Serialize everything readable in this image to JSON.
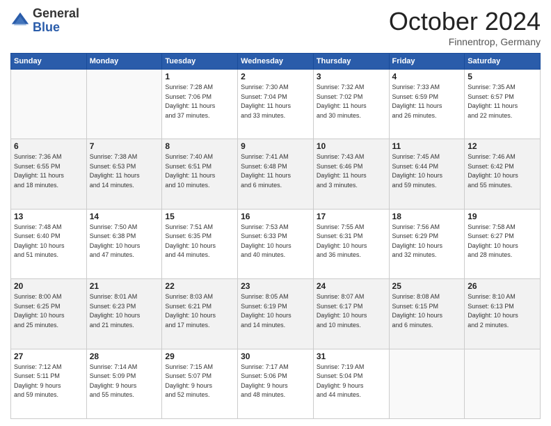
{
  "logo": {
    "general": "General",
    "blue": "Blue"
  },
  "header": {
    "title": "October 2024",
    "subtitle": "Finnentrop, Germany"
  },
  "weekdays": [
    "Sunday",
    "Monday",
    "Tuesday",
    "Wednesday",
    "Thursday",
    "Friday",
    "Saturday"
  ],
  "weeks": [
    [
      {
        "day": "",
        "info": ""
      },
      {
        "day": "",
        "info": ""
      },
      {
        "day": "1",
        "info": "Sunrise: 7:28 AM\nSunset: 7:06 PM\nDaylight: 11 hours\nand 37 minutes."
      },
      {
        "day": "2",
        "info": "Sunrise: 7:30 AM\nSunset: 7:04 PM\nDaylight: 11 hours\nand 33 minutes."
      },
      {
        "day": "3",
        "info": "Sunrise: 7:32 AM\nSunset: 7:02 PM\nDaylight: 11 hours\nand 30 minutes."
      },
      {
        "day": "4",
        "info": "Sunrise: 7:33 AM\nSunset: 6:59 PM\nDaylight: 11 hours\nand 26 minutes."
      },
      {
        "day": "5",
        "info": "Sunrise: 7:35 AM\nSunset: 6:57 PM\nDaylight: 11 hours\nand 22 minutes."
      }
    ],
    [
      {
        "day": "6",
        "info": "Sunrise: 7:36 AM\nSunset: 6:55 PM\nDaylight: 11 hours\nand 18 minutes."
      },
      {
        "day": "7",
        "info": "Sunrise: 7:38 AM\nSunset: 6:53 PM\nDaylight: 11 hours\nand 14 minutes."
      },
      {
        "day": "8",
        "info": "Sunrise: 7:40 AM\nSunset: 6:51 PM\nDaylight: 11 hours\nand 10 minutes."
      },
      {
        "day": "9",
        "info": "Sunrise: 7:41 AM\nSunset: 6:48 PM\nDaylight: 11 hours\nand 6 minutes."
      },
      {
        "day": "10",
        "info": "Sunrise: 7:43 AM\nSunset: 6:46 PM\nDaylight: 11 hours\nand 3 minutes."
      },
      {
        "day": "11",
        "info": "Sunrise: 7:45 AM\nSunset: 6:44 PM\nDaylight: 10 hours\nand 59 minutes."
      },
      {
        "day": "12",
        "info": "Sunrise: 7:46 AM\nSunset: 6:42 PM\nDaylight: 10 hours\nand 55 minutes."
      }
    ],
    [
      {
        "day": "13",
        "info": "Sunrise: 7:48 AM\nSunset: 6:40 PM\nDaylight: 10 hours\nand 51 minutes."
      },
      {
        "day": "14",
        "info": "Sunrise: 7:50 AM\nSunset: 6:38 PM\nDaylight: 10 hours\nand 47 minutes."
      },
      {
        "day": "15",
        "info": "Sunrise: 7:51 AM\nSunset: 6:35 PM\nDaylight: 10 hours\nand 44 minutes."
      },
      {
        "day": "16",
        "info": "Sunrise: 7:53 AM\nSunset: 6:33 PM\nDaylight: 10 hours\nand 40 minutes."
      },
      {
        "day": "17",
        "info": "Sunrise: 7:55 AM\nSunset: 6:31 PM\nDaylight: 10 hours\nand 36 minutes."
      },
      {
        "day": "18",
        "info": "Sunrise: 7:56 AM\nSunset: 6:29 PM\nDaylight: 10 hours\nand 32 minutes."
      },
      {
        "day": "19",
        "info": "Sunrise: 7:58 AM\nSunset: 6:27 PM\nDaylight: 10 hours\nand 28 minutes."
      }
    ],
    [
      {
        "day": "20",
        "info": "Sunrise: 8:00 AM\nSunset: 6:25 PM\nDaylight: 10 hours\nand 25 minutes."
      },
      {
        "day": "21",
        "info": "Sunrise: 8:01 AM\nSunset: 6:23 PM\nDaylight: 10 hours\nand 21 minutes."
      },
      {
        "day": "22",
        "info": "Sunrise: 8:03 AM\nSunset: 6:21 PM\nDaylight: 10 hours\nand 17 minutes."
      },
      {
        "day": "23",
        "info": "Sunrise: 8:05 AM\nSunset: 6:19 PM\nDaylight: 10 hours\nand 14 minutes."
      },
      {
        "day": "24",
        "info": "Sunrise: 8:07 AM\nSunset: 6:17 PM\nDaylight: 10 hours\nand 10 minutes."
      },
      {
        "day": "25",
        "info": "Sunrise: 8:08 AM\nSunset: 6:15 PM\nDaylight: 10 hours\nand 6 minutes."
      },
      {
        "day": "26",
        "info": "Sunrise: 8:10 AM\nSunset: 6:13 PM\nDaylight: 10 hours\nand 2 minutes."
      }
    ],
    [
      {
        "day": "27",
        "info": "Sunrise: 7:12 AM\nSunset: 5:11 PM\nDaylight: 9 hours\nand 59 minutes."
      },
      {
        "day": "28",
        "info": "Sunrise: 7:14 AM\nSunset: 5:09 PM\nDaylight: 9 hours\nand 55 minutes."
      },
      {
        "day": "29",
        "info": "Sunrise: 7:15 AM\nSunset: 5:07 PM\nDaylight: 9 hours\nand 52 minutes."
      },
      {
        "day": "30",
        "info": "Sunrise: 7:17 AM\nSunset: 5:06 PM\nDaylight: 9 hours\nand 48 minutes."
      },
      {
        "day": "31",
        "info": "Sunrise: 7:19 AM\nSunset: 5:04 PM\nDaylight: 9 hours\nand 44 minutes."
      },
      {
        "day": "",
        "info": ""
      },
      {
        "day": "",
        "info": ""
      }
    ]
  ]
}
